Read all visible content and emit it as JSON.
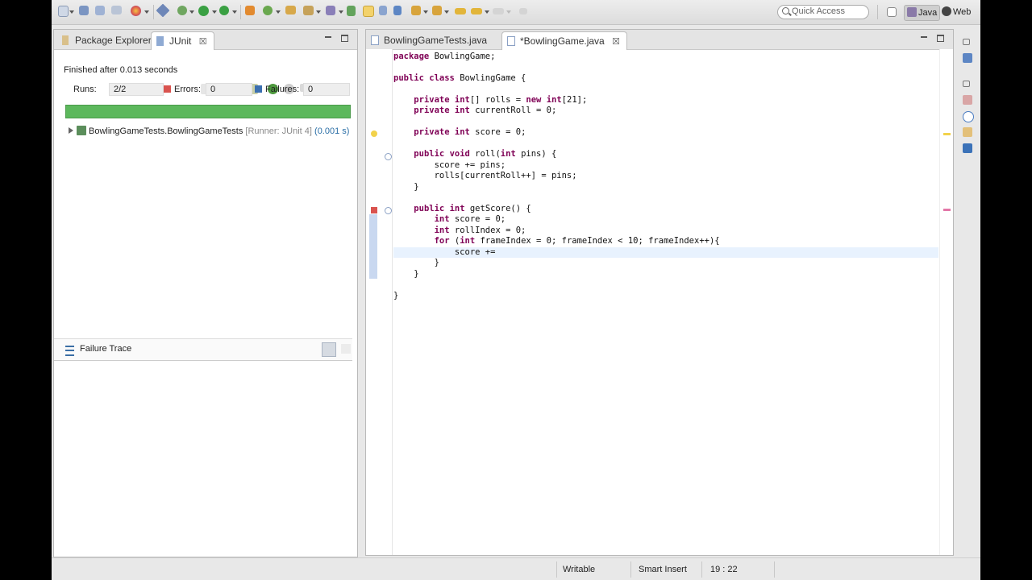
{
  "toolbar": {
    "quick_access_placeholder": "Quick Access",
    "perspectives": [
      {
        "label": "Java",
        "icon": "java-perspective-icon"
      },
      {
        "label": "Web",
        "icon": "web-perspective-icon"
      }
    ]
  },
  "left_panel": {
    "tabs": [
      {
        "label": "Package Explorer",
        "icon": "package-explorer-icon",
        "active": false
      },
      {
        "label": "JUnit",
        "icon": "junit-icon",
        "active": true,
        "close": "☒"
      }
    ],
    "status": "Finished after 0.013 seconds",
    "runs_label": "Runs:",
    "runs_value": "2/2",
    "errors_label": "Errors:",
    "errors_value": "0",
    "failures_label": "Failures:",
    "failures_value": "0",
    "progress_fraction": 1.0,
    "progress_color": "#5cb85c",
    "tree_item": {
      "name": "BowlingGameTests.BowlingGameTests",
      "runner": "[Runner: JUnit 4]",
      "time": "(0.001 s)"
    },
    "failure_trace_label": "Failure Trace"
  },
  "editor": {
    "tabs": [
      {
        "label": "BowlingGameTests.java",
        "active": false
      },
      {
        "label": "*BowlingGame.java",
        "active": true,
        "close": "☒"
      }
    ],
    "lines": [
      {
        "text": "package BowlingGame;"
      },
      {
        "text": ""
      },
      {
        "text": "public class BowlingGame {"
      },
      {
        "text": ""
      },
      {
        "text": "    private int[] rolls = new int[21];"
      },
      {
        "text": "    private int currentRoll = 0;"
      },
      {
        "text": ""
      },
      {
        "text": "    private int score = 0;"
      },
      {
        "text": ""
      },
      {
        "text": "    public void roll(int pins) {"
      },
      {
        "text": "        score += pins;"
      },
      {
        "text": "        rolls[currentRoll++] = pins;"
      },
      {
        "text": "    }"
      },
      {
        "text": ""
      },
      {
        "text": "    public int getScore() {"
      },
      {
        "text": "        int score = 0;"
      },
      {
        "text": "        int rollIndex = 0;"
      },
      {
        "text": "        for (int frameIndex = 0; frameIndex < 10; frameIndex++){"
      },
      {
        "text": "            score +="
      },
      {
        "text": "        }"
      },
      {
        "text": "    }"
      },
      {
        "text": ""
      },
      {
        "text": "}"
      }
    ],
    "current_line_color": "#e8f2fe"
  },
  "statusbar": {
    "writable": "Writable",
    "insert_mode": "Smart Insert",
    "position": "19 : 22"
  }
}
